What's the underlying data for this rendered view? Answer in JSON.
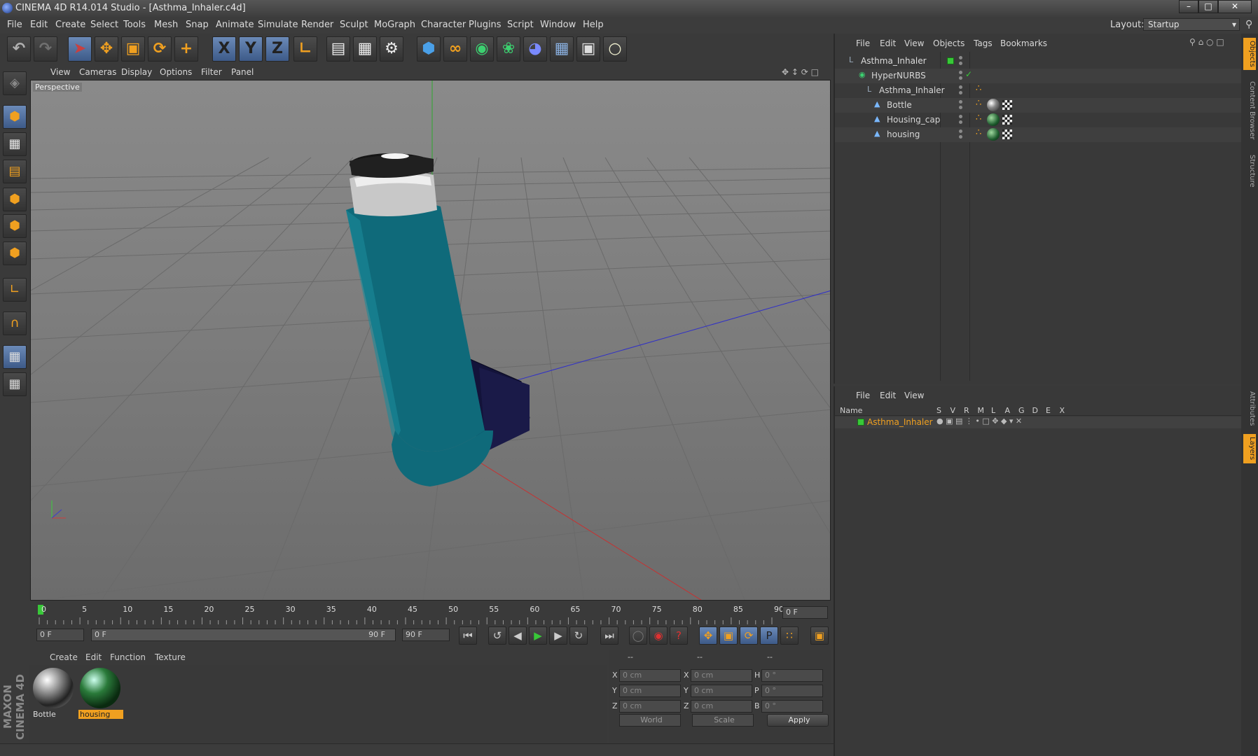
{
  "window": {
    "title": "CINEMA 4D R14.014 Studio - [Asthma_Inhaler.c4d]"
  },
  "menubar": {
    "items": [
      "File",
      "Edit",
      "Create",
      "Select",
      "Tools",
      "Mesh",
      "Snap",
      "Animate",
      "Simulate",
      "Render",
      "Sculpt",
      "MoGraph",
      "Character",
      "Plugins",
      "Script",
      "Window",
      "Help"
    ],
    "layout_label": "Layout:",
    "layout_value": "Startup"
  },
  "toolbar": {
    "icons": [
      "undo-icon",
      "redo-icon",
      "live-selection-icon",
      "move-icon",
      "scale-icon",
      "rotate-icon",
      "add-object-icon",
      "x-axis-icon",
      "y-axis-icon",
      "z-axis-icon",
      "world-coordinate-icon",
      "render-view-icon",
      "render-picture-viewer-icon",
      "render-settings-icon",
      "cube-icon",
      "spline-icon",
      "nurbs-icon",
      "array-icon",
      "deformer-icon",
      "floor-icon",
      "camera-icon",
      "light-icon"
    ],
    "axis_labels": [
      "X",
      "Y",
      "Z"
    ]
  },
  "viewport": {
    "menu": [
      "View",
      "Cameras",
      "Display",
      "Options",
      "Filter",
      "Panel"
    ],
    "label": "Perspective"
  },
  "timeline": {
    "ticks": [
      "0",
      "5",
      "10",
      "15",
      "20",
      "25",
      "30",
      "35",
      "40",
      "45",
      "50",
      "55",
      "60",
      "65",
      "70",
      "75",
      "80",
      "85",
      "90"
    ],
    "current_frame": "0 F"
  },
  "transport": {
    "start_field": "0 F",
    "range_start": "0 F",
    "range_end": "90 F",
    "end_field": "90 F"
  },
  "materials": {
    "menu": [
      "Create",
      "Edit",
      "Function",
      "Texture"
    ],
    "items": [
      {
        "name": "Bottle",
        "selected": false
      },
      {
        "name": "housing",
        "selected": true
      }
    ]
  },
  "coordinates": {
    "header": [
      "--",
      "--",
      "--"
    ],
    "rows": [
      {
        "a": "X",
        "av": "0 cm",
        "b": "X",
        "bv": "0 cm",
        "c": "H",
        "cv": "0 °"
      },
      {
        "a": "Y",
        "av": "0 cm",
        "b": "Y",
        "bv": "0 cm",
        "c": "P",
        "cv": "0 °"
      },
      {
        "a": "Z",
        "av": "0 cm",
        "b": "Z",
        "bv": "0 cm",
        "c": "B",
        "cv": "0 °"
      }
    ],
    "mode1": "World",
    "mode2": "Scale",
    "apply": "Apply"
  },
  "object_manager": {
    "menu": [
      "File",
      "Edit",
      "View",
      "Objects",
      "Tags",
      "Bookmarks"
    ],
    "objects": [
      {
        "name": "Asthma_Inhaler"
      },
      {
        "name": "HyperNURBS"
      },
      {
        "name": "Asthma_Inhaler"
      },
      {
        "name": "Bottle"
      },
      {
        "name": "Housing_cap"
      },
      {
        "name": "housing"
      }
    ]
  },
  "layer_manager": {
    "menu": [
      "File",
      "Edit",
      "View"
    ],
    "columns": [
      "Name",
      "S",
      "V",
      "R",
      "M",
      "L",
      "A",
      "G",
      "D",
      "E",
      "X"
    ],
    "layers": [
      {
        "name": "Asthma_Inhaler",
        "color": "#2ec82e"
      }
    ]
  },
  "sidetabs": [
    "Objects",
    "Content Browser",
    "Structure",
    "Attributes",
    "Layers"
  ],
  "brand": "MAXON CINEMA 4D",
  "colors": {
    "accent": "#f0a020",
    "inhaler_body": "#0f6a7a",
    "layer_name": "#f0a020"
  }
}
